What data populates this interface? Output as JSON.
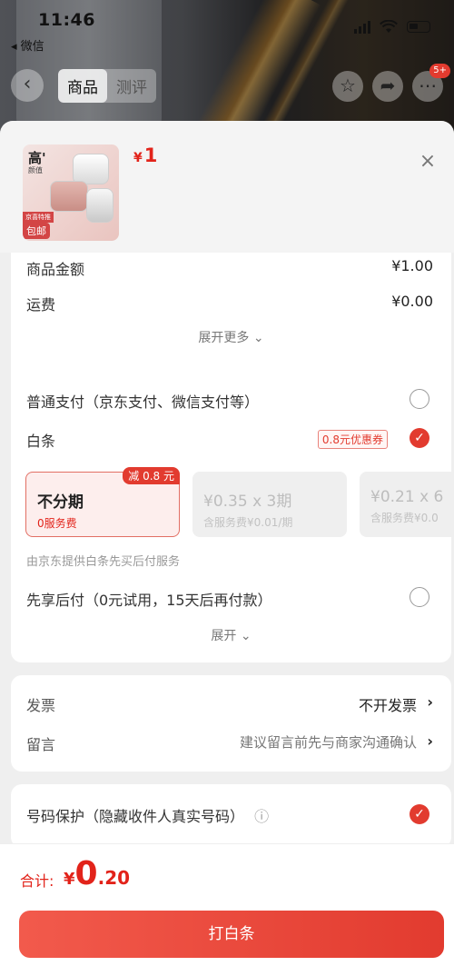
{
  "status_bar": {
    "time": "11:46",
    "back_app": "◂ 微信"
  },
  "nav": {
    "tabs": [
      "商品",
      "测评"
    ],
    "more_badge": "5+"
  },
  "product": {
    "thumb_title": "高'",
    "thumb_subtitle": "颜值",
    "thumb_tag": "京喜特推",
    "thumb_shipping": "包邮",
    "price_symbol": "¥",
    "price": "1",
    "close_label": "×"
  },
  "summary": {
    "goods_amount_label": "商品金额",
    "goods_amount_value": "¥1.00",
    "shipping_label": "运费",
    "shipping_value": "¥0.00",
    "expand_more": "展开更多 ⌄"
  },
  "payment": {
    "normal_label": "普通支付（京东支付、微信支付等）",
    "baitiao_label": "白条",
    "coupon": "0.8元优惠券",
    "plans": [
      {
        "title": "不分期",
        "sub": "0服务费",
        "badge": "减 0.8 元"
      },
      {
        "title": "¥0.35 x 3期",
        "sub": "含服务费¥0.01/期"
      },
      {
        "title": "¥0.21 x 6",
        "sub": "含服务费¥0.0"
      }
    ],
    "provider_note": "由京东提供白条先买后付服务",
    "later_label": "先享后付（0元试用，15天后再付款）",
    "expand": "展开 ⌄"
  },
  "invoice": {
    "invoice_label": "发票",
    "invoice_value": "不开发票",
    "message_label": "留言",
    "message_placeholder": "建议留言前先与商家沟通确认"
  },
  "privacy": {
    "label": "号码保护（隐藏收件人真实号码）",
    "info_icon": "ⓘ"
  },
  "footer": {
    "total_label": "合计:",
    "total_symbol": "¥",
    "total_int": "0",
    "total_dec": ".20",
    "pay_button": "打白条"
  }
}
